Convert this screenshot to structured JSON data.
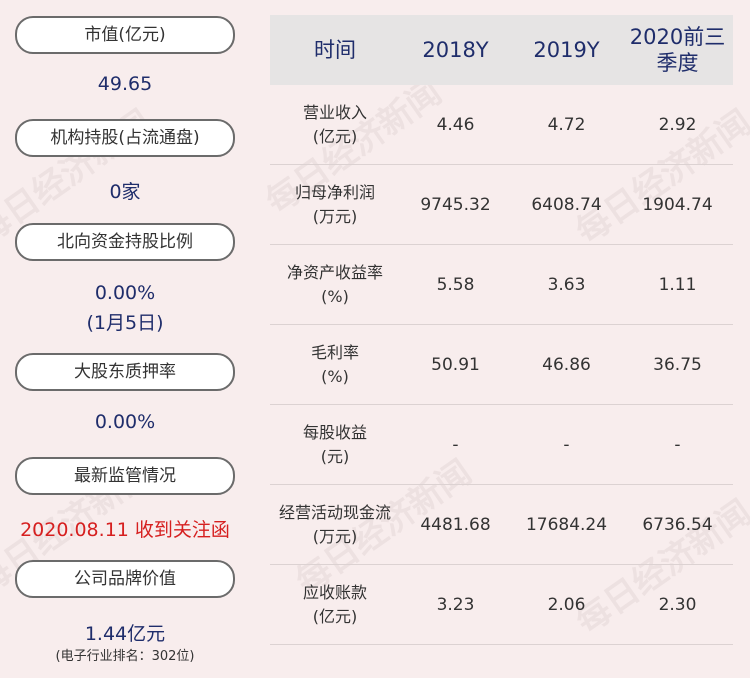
{
  "left": [
    {
      "label": "市值(亿元)",
      "value": "49.65",
      "value_color": "#1f2d6b"
    },
    {
      "label": "机构持股(占流通盘)",
      "value": "0家",
      "value_color": "#1f2d6b"
    },
    {
      "label": "北向资金持股比例",
      "value": "0.00%",
      "value2": "(1月5日)",
      "value_color": "#1f2d6b"
    },
    {
      "label": "大股东质押率",
      "value": "0.00%",
      "value_color": "#1f2d6b"
    },
    {
      "label": "最新监管情况",
      "value": "2020.08.11 收到关注函",
      "value_color": "#d62020"
    },
    {
      "label": "公司品牌价值",
      "value": "1.44亿元",
      "sub": "(电子行业排名：302位)",
      "value_color": "#1f2d6b"
    }
  ],
  "table": {
    "header": [
      "时间",
      "2018Y",
      "2019Y",
      "2020前三季度"
    ],
    "rows": [
      {
        "label": "营业收入",
        "unit": "(亿元)",
        "values": [
          "4.46",
          "4.72",
          "2.92"
        ]
      },
      {
        "label": "归母净利润",
        "unit": "(万元)",
        "values": [
          "9745.32",
          "6408.74",
          "1904.74"
        ]
      },
      {
        "label": "净资产收益率",
        "unit": "(%)",
        "values": [
          "5.58",
          "3.63",
          "1.11"
        ]
      },
      {
        "label": "毛利率",
        "unit": "(%)",
        "values": [
          "50.91",
          "46.86",
          "36.75"
        ]
      },
      {
        "label": "每股收益",
        "unit": "(元)",
        "values": [
          "-",
          "-",
          "-"
        ]
      },
      {
        "label": "经营活动现金流",
        "unit": "(万元)",
        "values": [
          "4481.68",
          "17684.24",
          "6736.54"
        ]
      },
      {
        "label": "应收账款",
        "unit": "(亿元)",
        "values": [
          "3.23",
          "2.06",
          "2.30"
        ]
      }
    ]
  },
  "watermark": "每日经济新闻"
}
